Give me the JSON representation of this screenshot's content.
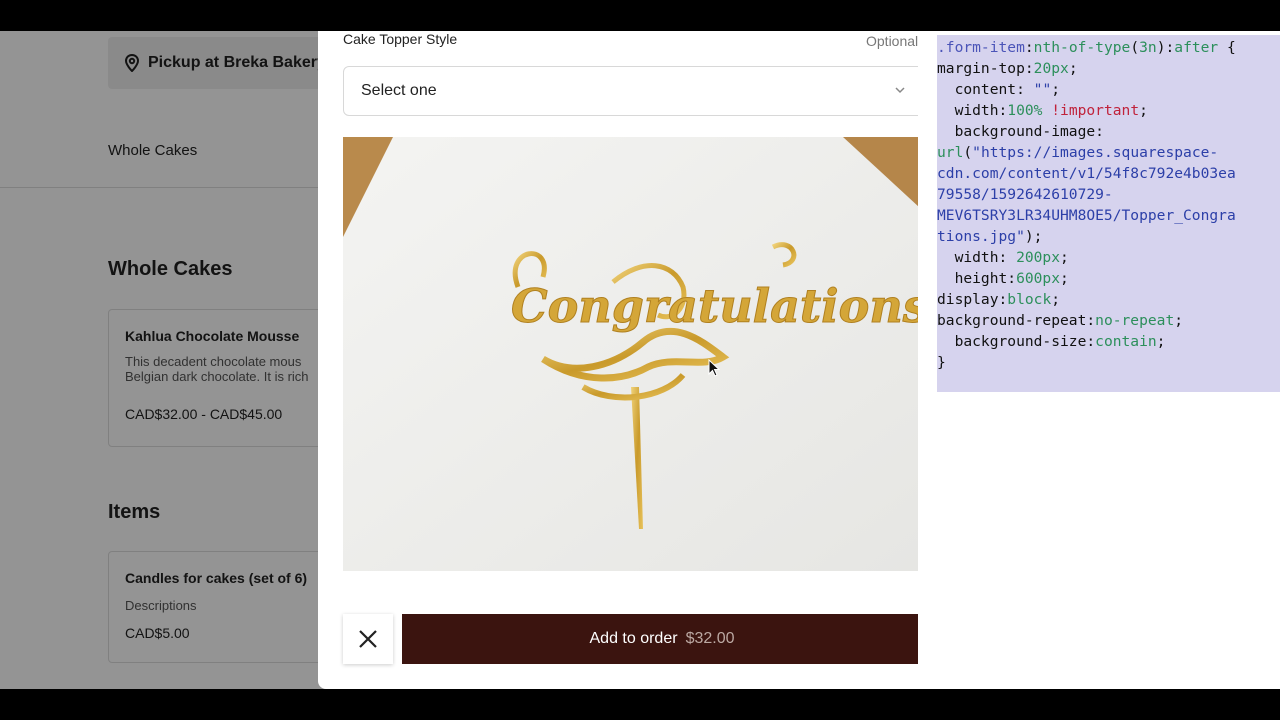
{
  "store": {
    "pickup_label": "Pickup at Breka Bakery",
    "tab_label": "Whole Cakes",
    "sections": [
      {
        "title": "Whole Cakes",
        "item": {
          "name": "Kahlua Chocolate Mousse",
          "desc_line1": "This decadent chocolate mous",
          "desc_line2": "Belgian dark chocolate. It is rich",
          "price": "CAD$32.00 - CAD$45.00"
        }
      },
      {
        "title": "Items",
        "item": {
          "name": "Candles for cakes (set of 6)",
          "desc_line1": "Descriptions",
          "price": "CAD$5.00"
        }
      }
    ]
  },
  "modal": {
    "field_label": "Cake Topper Style",
    "optional_label": "Optional",
    "select_placeholder": "Select one",
    "image_text": "Congratulations",
    "add_button_label": "Add to order",
    "add_button_price": "$32.00"
  },
  "code_panel": {
    "url_line1": "https://images.squarespace-",
    "url_line2": "cdn.com/content/v1/54f8c792e4b03ea",
    "url_line3": "79558/1592642610729-",
    "url_line4": "MEV6TSRY3LR34UHM8OE5/Topper_Congra",
    "url_line5": "tions.jpg"
  },
  "colors": {
    "button_bg": "#3b140f",
    "code_bg": "#d6d3ee"
  }
}
